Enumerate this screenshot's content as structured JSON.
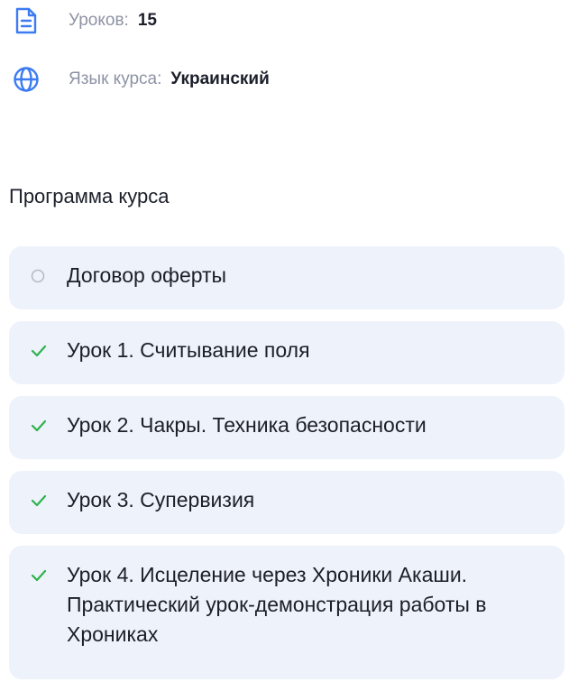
{
  "course_info": {
    "lessons_label": "Уроков:",
    "lessons_value": "15",
    "language_label": "Язык курса:",
    "language_value": "Украинский"
  },
  "program": {
    "title": "Программа курса",
    "items": [
      {
        "label": "Договор оферты",
        "status": "not-completed"
      },
      {
        "label": "Урок 1. Считывание поля",
        "status": "completed"
      },
      {
        "label": "Урок 2. Чакры. Техника безопасности",
        "status": "completed"
      },
      {
        "label": "Урок 3. Супервизия",
        "status": "completed"
      },
      {
        "label": "Урок 4. Исцеление через Хроники Акаши. Практический урок-демонстрация работы в Хрониках",
        "status": "completed"
      }
    ]
  },
  "colors": {
    "accent": "#3d7bf3",
    "check": "#2db24b",
    "card_bg": "#eef2fa",
    "muted_text": "#8e93a4"
  }
}
